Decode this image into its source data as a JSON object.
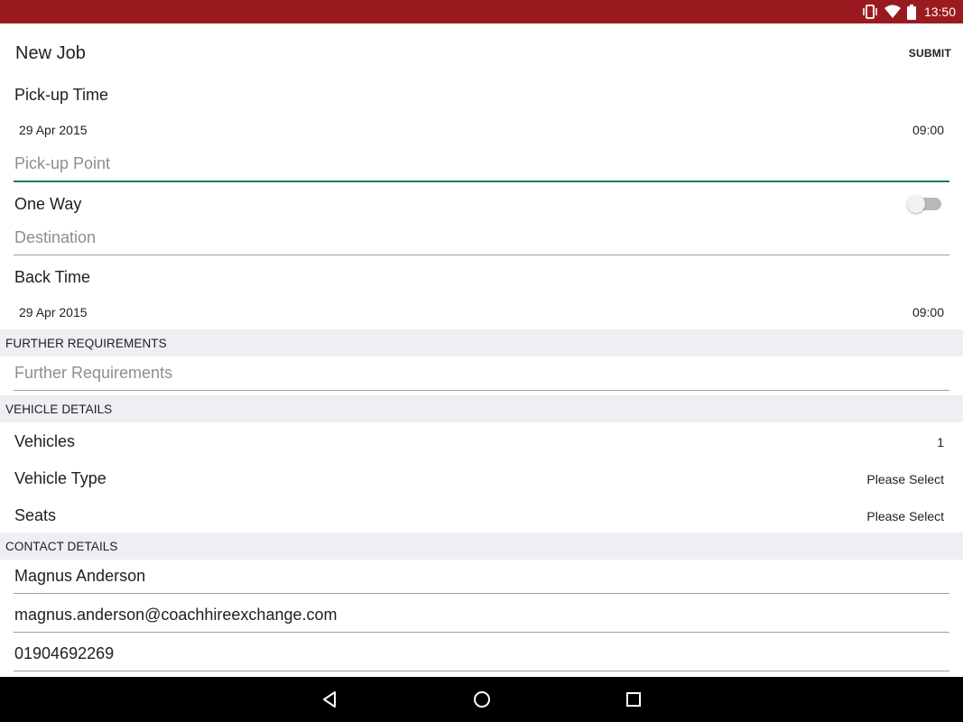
{
  "status_bar": {
    "time": "13:50",
    "icons": [
      "vibrate-icon",
      "wifi-icon",
      "battery-icon"
    ]
  },
  "toolbar": {
    "title": "New Job",
    "submit_label": "SUBMIT"
  },
  "pickup_time": {
    "label": "Pick-up Time",
    "date": "29 Apr 2015",
    "time": "09:00"
  },
  "pickup_point": {
    "placeholder": "Pick-up Point"
  },
  "one_way": {
    "label": "One Way",
    "checked": false
  },
  "destination": {
    "placeholder": "Destination"
  },
  "back_time": {
    "label": "Back Time",
    "date": "29 Apr 2015",
    "time": "09:00"
  },
  "further_requirements": {
    "header": "FURTHER REQUIREMENTS",
    "placeholder": "Further Requirements"
  },
  "vehicle_details": {
    "header": "VEHICLE DETAILS",
    "vehicles_label": "Vehicles",
    "vehicles_value": "1",
    "vehicle_type_label": "Vehicle Type",
    "vehicle_type_value": "Please Select",
    "seats_label": "Seats",
    "seats_value": "Please Select"
  },
  "contact_details": {
    "header": "CONTACT DETAILS",
    "name": "Magnus Anderson",
    "email": "magnus.anderson@coachhireexchange.com",
    "phone": "01904692269"
  },
  "colors": {
    "status_bar": "#9a1b1f",
    "accent": "#0b7d5c",
    "section_header": "#eeeef3"
  }
}
